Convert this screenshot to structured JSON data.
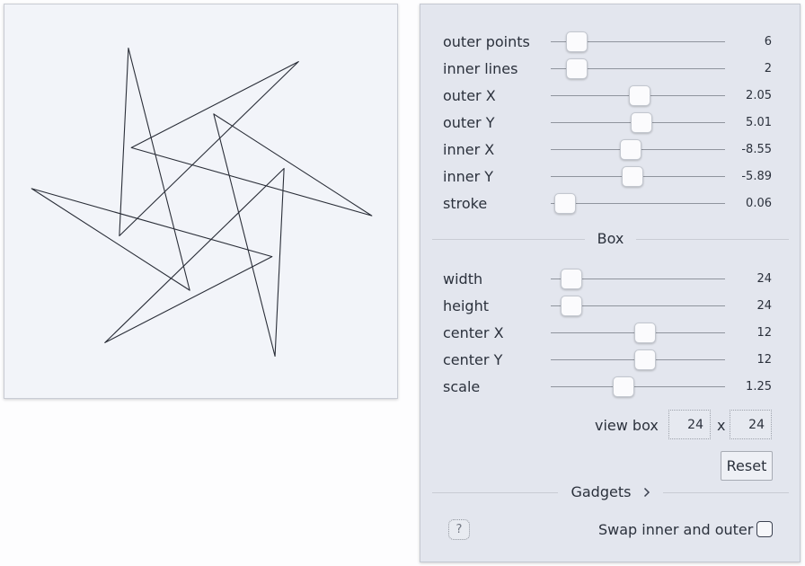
{
  "shape": {
    "outer_points": 6,
    "inner_lines": 2,
    "outer_x": 2.05,
    "outer_y": 5.01,
    "inner_x": -8.55,
    "inner_y": -5.89,
    "stroke": 0.06,
    "center": [
      12,
      12
    ],
    "stroke_color": "#2a2e38"
  },
  "controls": {
    "sliders": [
      {
        "label": "outer points",
        "value": "6",
        "fraction": 0.15
      },
      {
        "label": "inner lines",
        "value": "2",
        "fraction": 0.15
      },
      {
        "label": "outer X",
        "value": "2.05",
        "fraction": 0.51
      },
      {
        "label": "outer Y",
        "value": "5.01",
        "fraction": 0.52
      },
      {
        "label": "inner X",
        "value": "-8.55",
        "fraction": 0.46
      },
      {
        "label": "inner Y",
        "value": "-5.89",
        "fraction": 0.47
      },
      {
        "label": "stroke",
        "value": "0.06",
        "fraction": 0.08
      }
    ],
    "box_title": "Box",
    "box_sliders": [
      {
        "label": "width",
        "value": "24",
        "fraction": 0.12
      },
      {
        "label": "height",
        "value": "24",
        "fraction": 0.12
      },
      {
        "label": "center X",
        "value": "12",
        "fraction": 0.54
      },
      {
        "label": "center Y",
        "value": "12",
        "fraction": 0.54
      },
      {
        "label": "scale",
        "value": "1.25",
        "fraction": 0.42
      }
    ],
    "view_box_label": "view box",
    "view_box_width": "24",
    "view_box_x": "x",
    "view_box_height": "24",
    "reset_label": "Reset",
    "gadgets_label": "Gadgets",
    "help_label": "?",
    "swap_label": "Swap inner and outer",
    "swap_checked": false
  }
}
